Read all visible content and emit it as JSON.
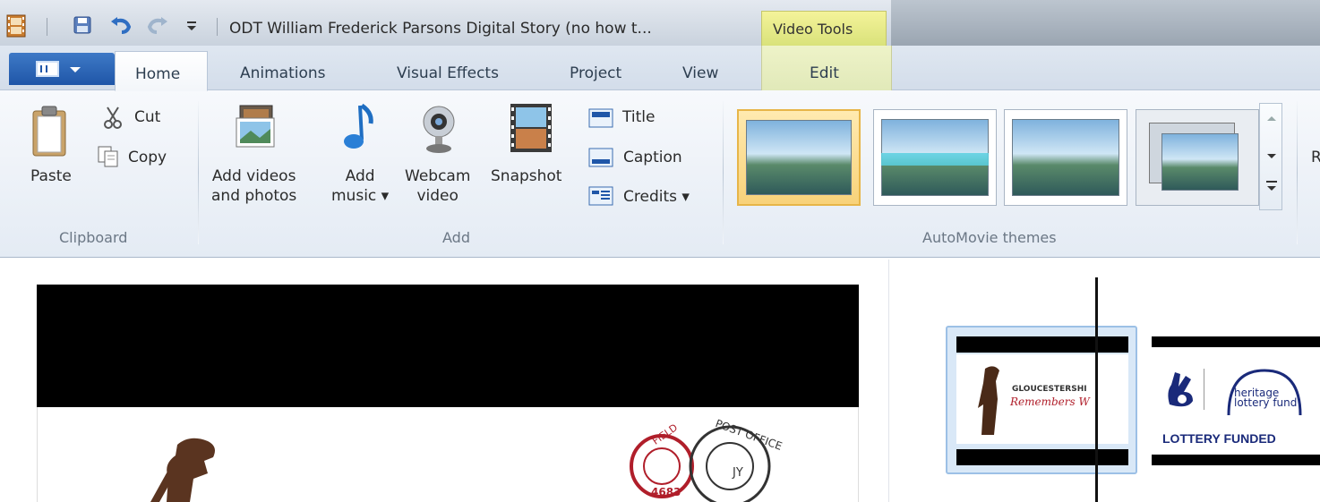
{
  "window": {
    "title": "ODT William Frederick Parsons Digital Story (no how t...",
    "context_tab": "Video Tools"
  },
  "ribbon_tabs": [
    "Home",
    "Animations",
    "Visual Effects",
    "Project",
    "View",
    "Edit"
  ],
  "clipboard": {
    "paste": "Paste",
    "cut": "Cut",
    "copy": "Copy",
    "group": "Clipboard"
  },
  "add": {
    "videos_line1": "Add videos",
    "videos_line2": "and photos",
    "music_line1": "Add",
    "music_line2": "music ▾",
    "webcam_line1": "Webcam",
    "webcam_line2": "video",
    "snapshot": "Snapshot",
    "title": "Title",
    "caption": "Caption",
    "credits": "Credits ▾",
    "group": "Add"
  },
  "themes": {
    "group": "AutoMovie themes",
    "count": 4,
    "selected_index": 0,
    "next_label_partial": "R"
  },
  "timeline": {
    "clip1_text_line1": "GLOUCESTERSHI",
    "clip1_text_line2": "Remembers W",
    "clip2_heritage_line1": "heritage",
    "clip2_heritage_line2": "lottery fund",
    "clip2_caption": "LOTTERY FUNDED"
  },
  "preview": {
    "stamp_text_1": "FIELD",
    "stamp_text_2": "4683",
    "stamp_text_3": "POST OFFICE",
    "stamp_text_4": "JY"
  },
  "colors": {
    "accent": "#1f56a8",
    "selection": "#e7b548",
    "video_tools": "#e9ec8f"
  }
}
